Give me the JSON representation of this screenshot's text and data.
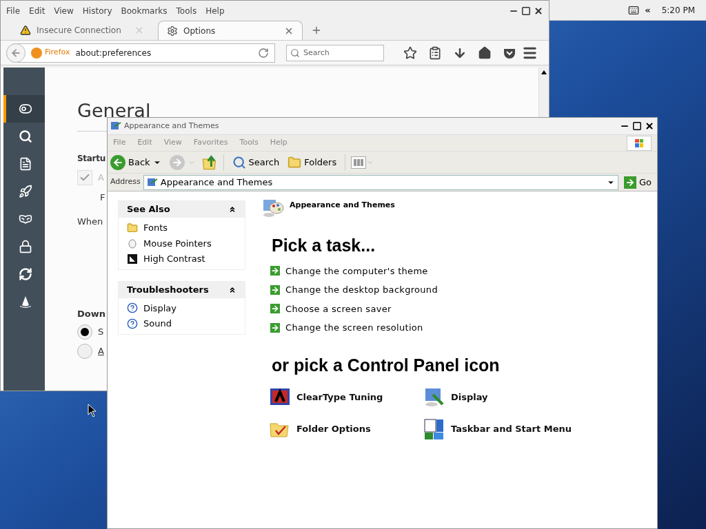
{
  "panel": {
    "collapse": "«",
    "clock": "5:20 PM"
  },
  "firefox": {
    "menu": [
      "File",
      "Edit",
      "View",
      "History",
      "Bookmarks",
      "Tools",
      "Help"
    ],
    "tabs": [
      {
        "label": "Insecure Connection",
        "selected": false,
        "kind": "warning"
      },
      {
        "label": "Options",
        "selected": true,
        "kind": "gear"
      }
    ],
    "identity": "Firefox",
    "url": "about:preferences",
    "search": {
      "placeholder": "Search"
    },
    "sidebar": [
      {
        "kind": "general",
        "selected": true
      },
      {
        "kind": "search",
        "selected": false
      },
      {
        "kind": "content",
        "selected": false
      },
      {
        "kind": "applications",
        "selected": false
      },
      {
        "kind": "privacy",
        "selected": false
      },
      {
        "kind": "security",
        "selected": false
      },
      {
        "kind": "sync",
        "selected": false
      },
      {
        "kind": "advanced",
        "selected": false
      }
    ],
    "page": {
      "title": "General",
      "startup_heading": "Startu",
      "checkbox": {
        "label": "A",
        "checked": true,
        "disabled": true
      },
      "line": "F",
      "when": "When",
      "downloads_heading": "Down",
      "radios": [
        {
          "label": "S",
          "selected": true,
          "underlined": false
        },
        {
          "label": "A",
          "selected": false,
          "underlined": true
        }
      ]
    }
  },
  "explorer": {
    "title": "Appearance and Themes",
    "menu": [
      {
        "label": "File",
        "disabled": true
      },
      {
        "label": "Edit",
        "disabled": true
      },
      {
        "label": "View",
        "disabled": true
      },
      {
        "label": "Favorites",
        "disabled": true
      },
      {
        "label": "Tools",
        "disabled": true
      },
      {
        "label": "Help",
        "disabled": true
      }
    ],
    "toolbar": {
      "back": "Back",
      "search": "Search",
      "folders": "Folders"
    },
    "address": {
      "label": "Address",
      "value": "Appearance and Themes",
      "go": "Go"
    },
    "panes": [
      {
        "title": "See Also",
        "expanded": true,
        "items": [
          {
            "label": "Fonts",
            "kind": "fonts"
          },
          {
            "label": "Mouse Pointers",
            "kind": "mouse"
          },
          {
            "label": "High Contrast",
            "kind": "contrast"
          }
        ]
      },
      {
        "title": "Troubleshooters",
        "expanded": true,
        "items": [
          {
            "label": "Display",
            "kind": "help"
          },
          {
            "label": "Sound",
            "kind": "help"
          }
        ]
      }
    ],
    "header": "Appearance and Themes",
    "task_heading": "Pick a task...",
    "tasks": [
      "Change the computer's theme",
      "Change the desktop background",
      "Choose a screen saver",
      "Change the screen resolution"
    ],
    "icon_heading": "or pick a Control Panel icon",
    "icons": [
      {
        "label": "ClearType Tuning",
        "kind": "cleartype"
      },
      {
        "label": "Display",
        "kind": "display"
      },
      {
        "label": "Folder Options",
        "kind": "folder"
      },
      {
        "label": "Taskbar and Start Menu",
        "kind": "taskbar"
      }
    ]
  }
}
